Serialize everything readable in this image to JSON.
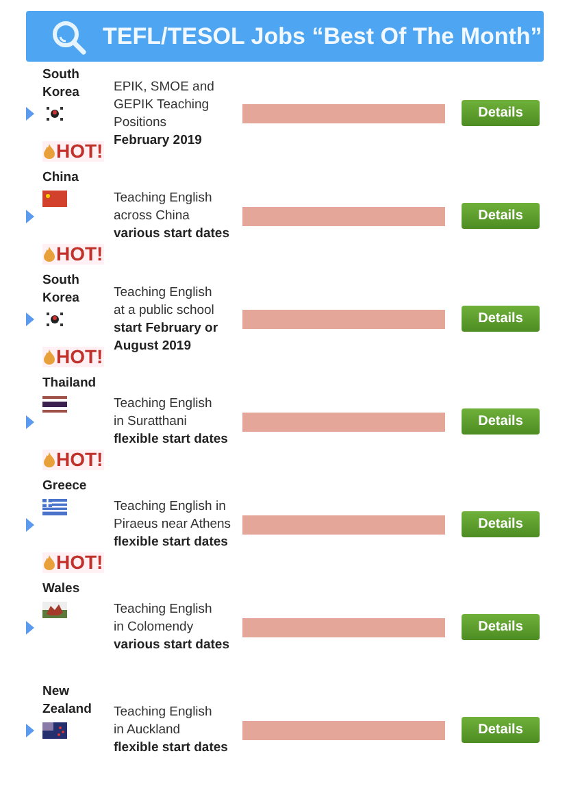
{
  "header": {
    "title": "TEFL/TESOL Jobs “Best Of The Month”"
  },
  "jobs": [
    {
      "country": "South Korea",
      "kind": "korea",
      "hot": true,
      "hot_label": "HOT!",
      "description": [
        "EPIK, SMOE and",
        "GEPIK Teaching",
        "Positions"
      ],
      "dates": [
        "February 2019"
      ],
      "button": "Details"
    },
    {
      "country": "China",
      "kind": "china",
      "hot": true,
      "hot_label": "HOT!",
      "description": [
        "Teaching English",
        "across China"
      ],
      "dates": [
        "various start dates"
      ],
      "button": "Details"
    },
    {
      "country": "South Korea",
      "kind": "korea",
      "hot": true,
      "hot_label": "HOT!",
      "description": [
        "Teaching English",
        "at a public school"
      ],
      "dates": [
        "start February or",
        "August 2019"
      ],
      "button": "Details"
    },
    {
      "country": "Thailand",
      "kind": "thailand",
      "hot": true,
      "hot_label": "HOT!",
      "description": [
        "Teaching English",
        "in Suratthani"
      ],
      "dates": [
        "flexible start dates"
      ],
      "button": "Details"
    },
    {
      "country": "Greece",
      "kind": "greece",
      "hot": true,
      "hot_label": "HOT!",
      "description": [
        "Teaching English in",
        "Piraeus near Athens"
      ],
      "dates": [
        "flexible start dates"
      ],
      "button": "Details"
    },
    {
      "country": "Wales",
      "kind": "wales",
      "hot": false,
      "description": [
        "Teaching English",
        "in Colomendy"
      ],
      "dates": [
        "various start dates"
      ],
      "button": "Details"
    },
    {
      "country": "New Zealand",
      "kind": "newzealand",
      "hot": false,
      "description": [
        "Teaching English",
        "in Auckland"
      ],
      "dates": [
        "flexible start dates"
      ],
      "button": "Details"
    }
  ]
}
